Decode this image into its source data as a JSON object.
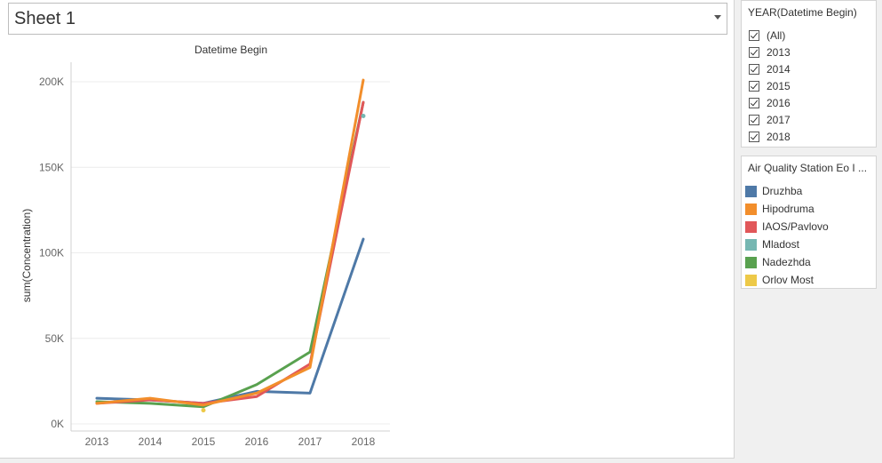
{
  "sheet": {
    "title": "Sheet 1"
  },
  "filter": {
    "title": "YEAR(Datetime Begin)",
    "items": [
      {
        "label": "(All)",
        "checked": true
      },
      {
        "label": "2013",
        "checked": true
      },
      {
        "label": "2014",
        "checked": true
      },
      {
        "label": "2015",
        "checked": true
      },
      {
        "label": "2016",
        "checked": true
      },
      {
        "label": "2017",
        "checked": true
      },
      {
        "label": "2018",
        "checked": true
      }
    ]
  },
  "legend": {
    "title": "Air Quality Station Eo I ...",
    "items": [
      {
        "label": "Druzhba",
        "color": "#4e79a7"
      },
      {
        "label": "Hipodruma",
        "color": "#f28e2b"
      },
      {
        "label": "IAOS/Pavlovo",
        "color": "#e15759"
      },
      {
        "label": "Mladost",
        "color": "#76b7b2"
      },
      {
        "label": "Nadezhda",
        "color": "#59a14f"
      },
      {
        "label": "Orlov Most",
        "color": "#edc948"
      }
    ]
  },
  "chart_data": {
    "type": "line",
    "title": "Datetime Begin",
    "xlabel": "",
    "ylabel": "sum(Concentration)",
    "x": [
      "2013",
      "2014",
      "2015",
      "2016",
      "2017",
      "2018"
    ],
    "ylim": [
      0,
      200000
    ],
    "yticks": [
      "0K",
      "50K",
      "100K",
      "150K",
      "200K"
    ],
    "series": [
      {
        "name": "Druzhba",
        "color": "#4e79a7",
        "values": [
          15000,
          14000,
          12000,
          19000,
          18000,
          108000
        ]
      },
      {
        "name": "Nadezhda",
        "color": "#59a14f",
        "values": [
          13000,
          12000,
          10000,
          23000,
          42000,
          188000
        ]
      },
      {
        "name": "IAOS/Pavlovo",
        "color": "#e15759",
        "values": [
          12000,
          14000,
          12000,
          16000,
          35000,
          188000
        ]
      },
      {
        "name": "Hipodruma",
        "color": "#f28e2b",
        "values": [
          12000,
          15000,
          11000,
          18000,
          33000,
          201000
        ]
      },
      {
        "name": "Orlov Most",
        "color": "#edc948",
        "values": [
          null,
          null,
          8000,
          null,
          null,
          null
        ]
      },
      {
        "name": "Mladost",
        "color": "#76b7b2",
        "values": [
          null,
          null,
          null,
          null,
          null,
          180000
        ]
      }
    ]
  }
}
